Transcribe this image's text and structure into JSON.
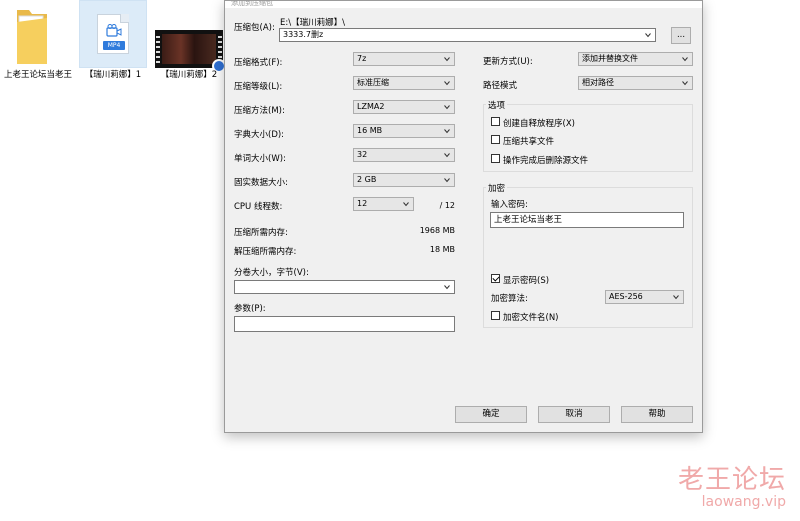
{
  "desktop": {
    "icons": [
      {
        "label": "上老王论坛当老王",
        "type": "folder-icon"
      },
      {
        "label": "【瑞川莉娜】1",
        "type": "mp4-file-icon",
        "badge": "MP4"
      },
      {
        "label": "【瑞川莉娜】2",
        "type": "video-thumbnail-icon"
      }
    ]
  },
  "dialog": {
    "title": "添加到压缩包",
    "archive": {
      "label": "压缩包(A):",
      "path": "E:\\【瑞川莉娜】\\",
      "value": "3333.7删z",
      "browse": "..."
    },
    "left": {
      "format": {
        "label": "压缩格式(F):",
        "value": "7z"
      },
      "level": {
        "label": "压缩等级(L):",
        "value": "标准压缩"
      },
      "method": {
        "label": "压缩方法(M):",
        "value": "LZMA2"
      },
      "dict": {
        "label": "字典大小(D):",
        "value": "16 MB"
      },
      "word": {
        "label": "单词大小(W):",
        "value": "32"
      },
      "solid": {
        "label": "固实数据大小:",
        "value": "2 GB"
      },
      "cpu": {
        "label": "CPU 线程数:",
        "value": "12",
        "total": "/ 12"
      },
      "mem_compress": {
        "label": "压缩所需内存:",
        "value": "1968 MB"
      },
      "mem_decompress": {
        "label": "解压缩所需内存:",
        "value": "18 MB"
      },
      "split": {
        "label": "分卷大小，字节(V):",
        "value": ""
      },
      "params": {
        "label": "参数(P):",
        "value": ""
      }
    },
    "right": {
      "update": {
        "label": "更新方式(U):",
        "value": "添加并替换文件"
      },
      "pathmode": {
        "label": "路径模式",
        "value": "相对路径"
      },
      "options": {
        "title": "选项",
        "sfx": {
          "label": "创建自释放程序(X)",
          "checked": false
        },
        "shared": {
          "label": "压缩共享文件",
          "checked": false
        },
        "delete": {
          "label": "操作完成后删除源文件",
          "checked": false
        }
      },
      "encryption": {
        "title": "加密",
        "pw_label": "输入密码:",
        "pw_value": "上老王论坛当老王",
        "show": {
          "label": "显示密码(S)",
          "checked": true
        },
        "method_label": "加密算法:",
        "method_value": "AES-256",
        "names": {
          "label": "加密文件名(N)",
          "checked": false
        }
      }
    },
    "buttons": {
      "ok": "确定",
      "cancel": "取消",
      "help": "帮助"
    }
  },
  "watermark": {
    "cn": "老王论坛",
    "en": "laowang.vip"
  }
}
